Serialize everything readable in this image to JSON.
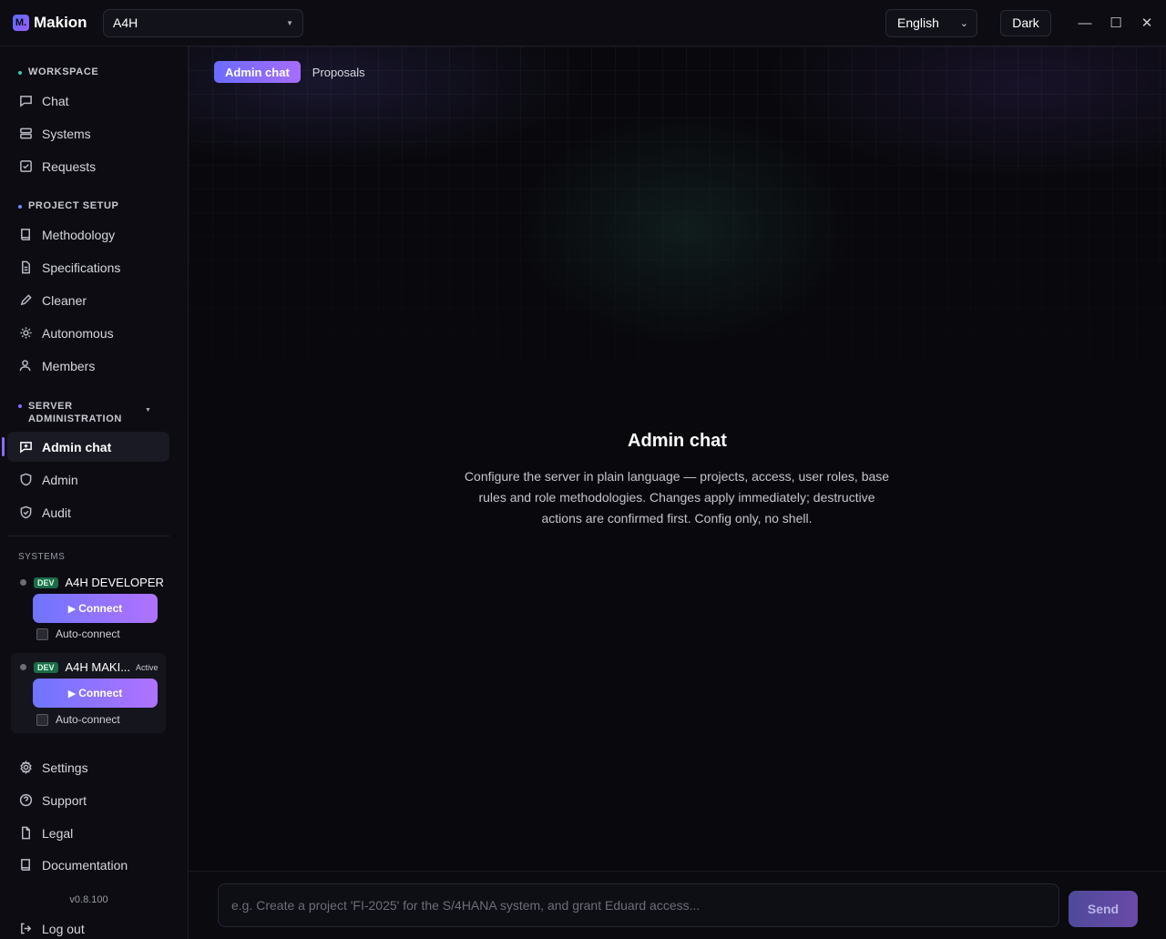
{
  "app": {
    "logo_mark": "M.",
    "name": "Makion"
  },
  "header": {
    "project": "A4H",
    "language": "English",
    "theme": "Dark",
    "window_controls": {
      "minimize": "—",
      "maximize": "☐",
      "close": "✕"
    }
  },
  "sidebar": {
    "workspace": {
      "heading": "WORKSPACE",
      "items": [
        {
          "label": "Chat",
          "icon": "chat-icon"
        },
        {
          "label": "Systems",
          "icon": "server-icon"
        },
        {
          "label": "Requests",
          "icon": "check-square-icon"
        }
      ]
    },
    "project_setup": {
      "heading": "PROJECT SETUP",
      "items": [
        {
          "label": "Methodology",
          "icon": "book-icon"
        },
        {
          "label": "Specifications",
          "icon": "file-icon"
        },
        {
          "label": "Cleaner",
          "icon": "pencil-icon"
        },
        {
          "label": "Autonomous",
          "icon": "sun-icon"
        },
        {
          "label": "Members",
          "icon": "user-icon"
        }
      ]
    },
    "server_admin": {
      "heading_line1": "SERVER",
      "heading_line2": "ADMINISTRATION",
      "items": [
        {
          "label": "Admin chat",
          "icon": "chat-edit-icon",
          "active": true
        },
        {
          "label": "Admin",
          "icon": "shield-icon"
        },
        {
          "label": "Audit",
          "icon": "shield-check-icon"
        }
      ]
    },
    "systems": {
      "heading": "SYSTEMS",
      "list": [
        {
          "badge": "DEV",
          "name": "A4H DEVELOPER",
          "state": "",
          "connect": "Connect",
          "autoconnect": "Auto-connect",
          "autoconnect_checked": false
        },
        {
          "badge": "DEV",
          "name": "A4H MAKI...",
          "state": "Active",
          "connect": "Connect",
          "autoconnect": "Auto-connect",
          "autoconnect_checked": false
        }
      ]
    },
    "footer": {
      "items": [
        {
          "label": "Settings",
          "icon": "gear-icon"
        },
        {
          "label": "Support",
          "icon": "help-circle-icon"
        },
        {
          "label": "Legal",
          "icon": "file-icon"
        },
        {
          "label": "Documentation",
          "icon": "book-icon"
        }
      ],
      "version": "v0.8.100",
      "logout": "Log out"
    }
  },
  "main": {
    "tabs": [
      {
        "label": "Admin chat",
        "selected": true
      },
      {
        "label": "Proposals",
        "selected": false
      }
    ],
    "empty_title": "Admin chat",
    "empty_description": "Configure the server in plain language — projects, access, user roles, base rules and role methodologies. Changes apply immediately; destructive actions are confirmed first. Config only, no shell."
  },
  "composer": {
    "placeholder": "e.g. Create a project 'FI-2025' for the S/4HANA system, and grant Eduard access...",
    "value": "",
    "send_label": "Send"
  },
  "colors": {
    "accent_start": "#6a6cff",
    "accent_end": "#a66cff",
    "workspace_dot": "#38c8b0",
    "project_setup_dot": "#6c8cff",
    "server_admin_dot": "#8a6cff",
    "dev_badge": "#1d6b48"
  }
}
